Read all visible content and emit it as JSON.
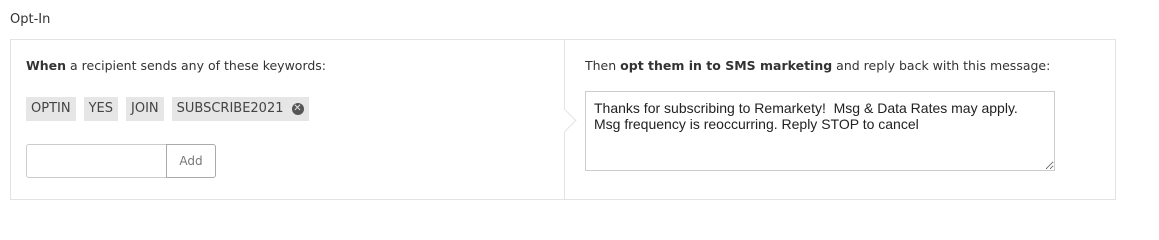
{
  "section": {
    "title": "Opt-In"
  },
  "left": {
    "instruction_bold": "When",
    "instruction_rest": " a recipient sends any of these keywords:",
    "keywords": [
      {
        "label": "OPTIN"
      },
      {
        "label": "YES"
      },
      {
        "label": "JOIN"
      },
      {
        "label": "SUBSCRIBE2021",
        "removable": true
      }
    ],
    "add_input_value": "",
    "add_button_label": "Add"
  },
  "right": {
    "instruction_prefix": "Then ",
    "instruction_bold": "opt them in to SMS marketing",
    "instruction_suffix": " and reply back with this message:",
    "message": "Thanks for subscribing to Remarkety!  Msg & Data Rates may apply. Msg frequency is reoccurring. Reply STOP to cancel"
  },
  "icons": {
    "tag_remove": "close-circle-icon"
  },
  "colors": {
    "tag_bg": "#e6e6e6",
    "border": "#e3e3e3",
    "text": "#333333"
  }
}
